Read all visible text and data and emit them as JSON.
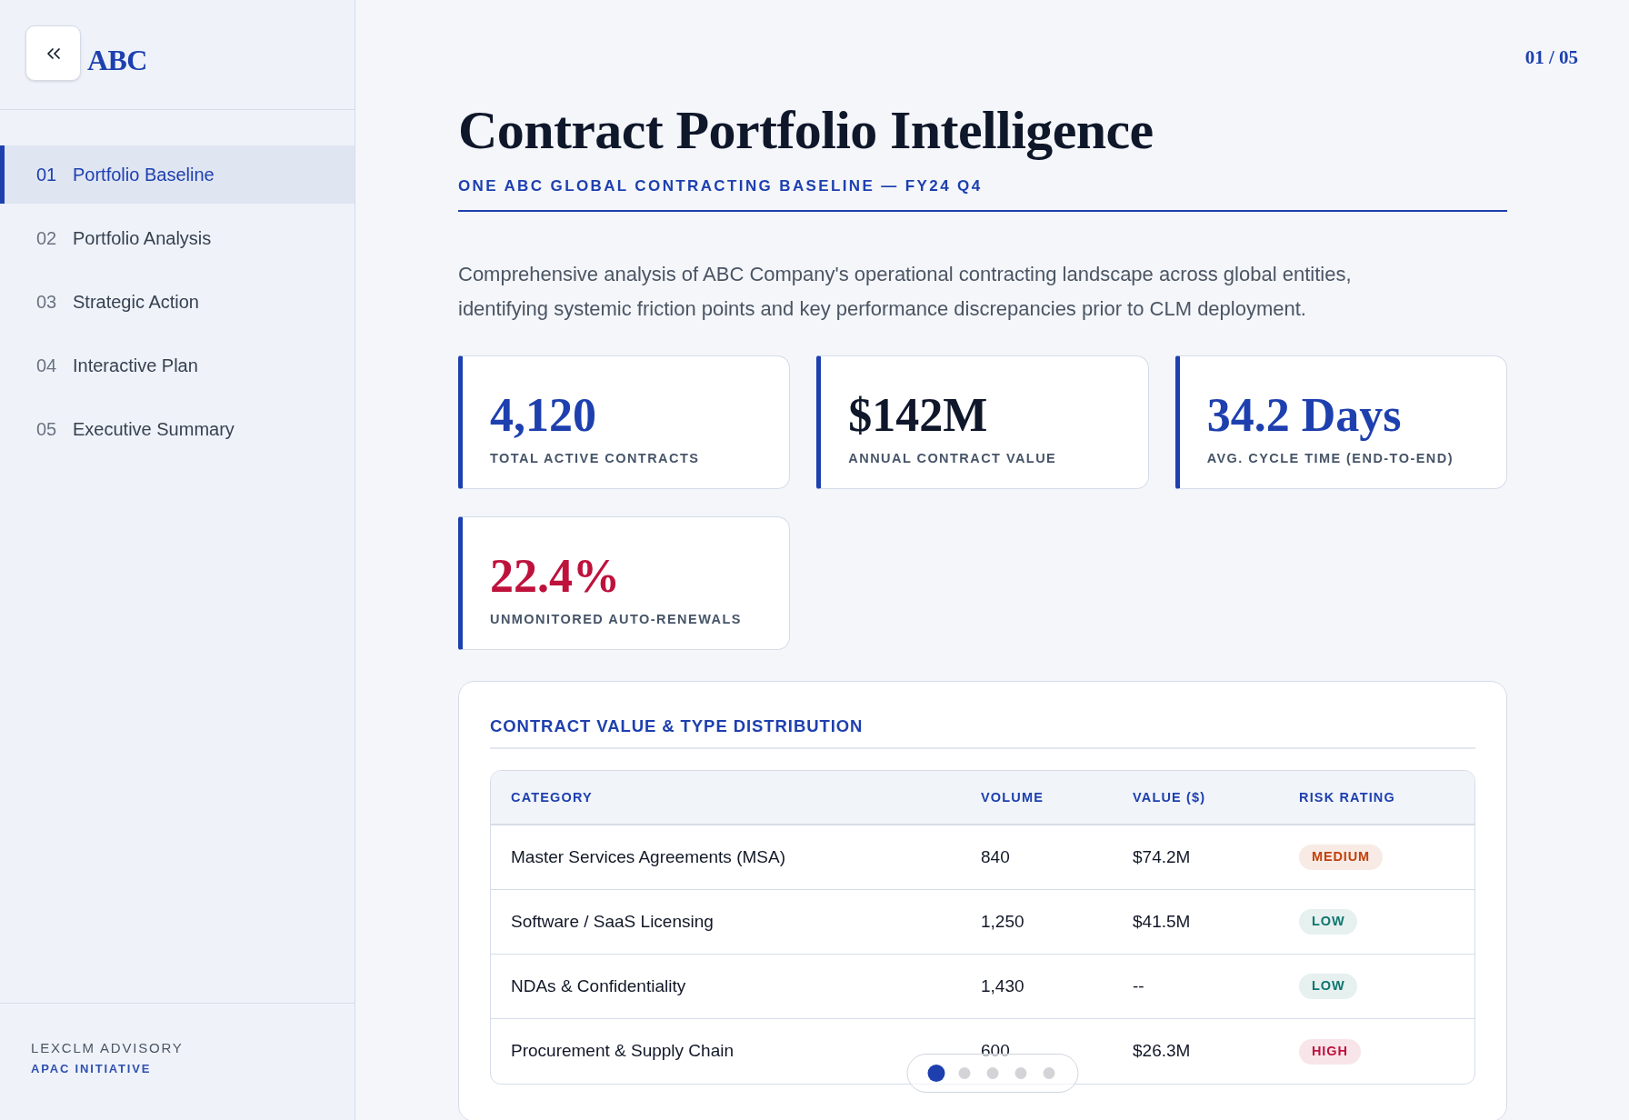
{
  "sidebar": {
    "logo": "ABC",
    "nav": [
      {
        "number": "01",
        "label": "Portfolio Baseline",
        "selected": true
      },
      {
        "number": "02",
        "label": "Portfolio Analysis",
        "selected": false
      },
      {
        "number": "03",
        "label": "Strategic Action",
        "selected": false
      },
      {
        "number": "04",
        "label": "Interactive Plan",
        "selected": false
      },
      {
        "number": "05",
        "label": "Executive Summary",
        "selected": false
      }
    ],
    "footer": {
      "company": "LEXCLM ADVISORY",
      "initiative": "APAC INITIATIVE"
    }
  },
  "page_counter": "01 / 05",
  "header": {
    "title": "Contract Portfolio Intelligence",
    "subtitle": "ONE ABC GLOBAL CONTRACTING BASELINE — FY24 Q4"
  },
  "intro": "Comprehensive analysis of ABC Company's operational contracting landscape across global entities, identifying systemic friction points and key performance discrepancies prior to CLM deployment.",
  "stats": [
    {
      "value": "4,120",
      "label": "TOTAL ACTIVE CONTRACTS",
      "color": "#1e40af"
    },
    {
      "value": "$142M",
      "label": "ANNUAL CONTRACT VALUE",
      "color": "#0f172a"
    },
    {
      "value": "34.2 Days",
      "label": "AVG. CYCLE TIME (END-TO-END)",
      "color": "#1e40af"
    },
    {
      "value": "22.4%",
      "label": "UNMONITORED AUTO-RENEWALS",
      "color": "#be123c"
    }
  ],
  "distribution": {
    "title": "CONTRACT VALUE & TYPE DISTRIBUTION",
    "columns": [
      "CATEGORY",
      "VOLUME",
      "VALUE ($)",
      "RISK RATING"
    ],
    "rows": [
      {
        "category": "Master Services Agreements (MSA)",
        "volume": "840",
        "value": "$74.2M",
        "risk": {
          "label": "MEDIUM",
          "color": "#c2410c"
        }
      },
      {
        "category": "Software / SaaS Licensing",
        "volume": "1,250",
        "value": "$41.5M",
        "risk": {
          "label": "LOW",
          "color": "#0f766e"
        }
      },
      {
        "category": "NDAs & Confidentiality",
        "volume": "1,430",
        "value": "--",
        "risk": {
          "label": "LOW",
          "color": "#0f766e"
        }
      },
      {
        "category": "Procurement & Supply Chain",
        "volume": "600",
        "value": "$26.3M",
        "risk": {
          "label": "HIGH",
          "color": "#be123c"
        }
      }
    ]
  },
  "pager": {
    "dots": [
      {
        "selected": true
      },
      {
        "selected": false
      },
      {
        "selected": false
      },
      {
        "selected": false
      },
      {
        "selected": false
      }
    ]
  }
}
